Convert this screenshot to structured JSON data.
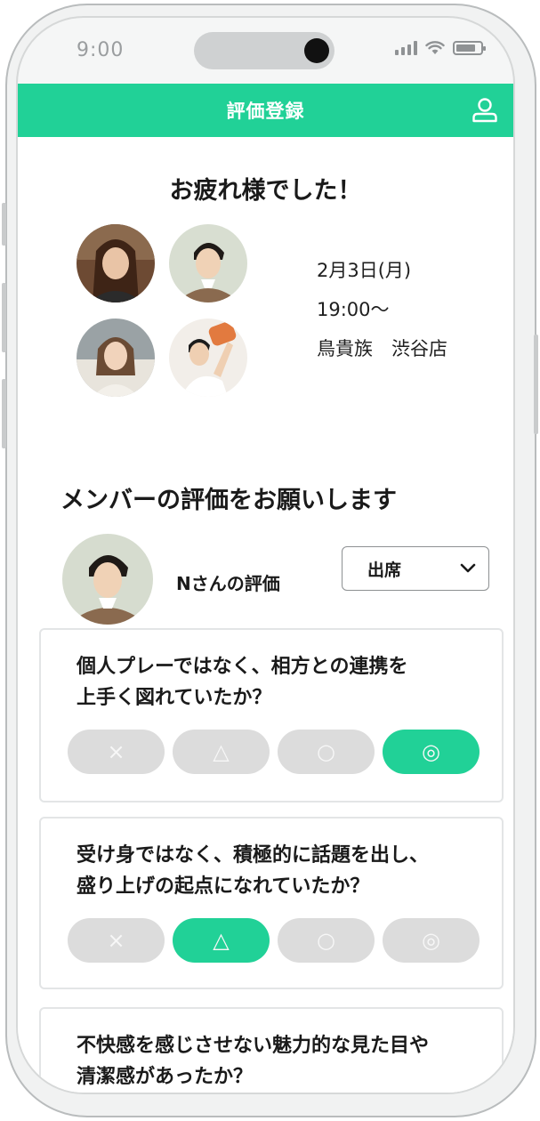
{
  "status_bar": {
    "time": "9:00"
  },
  "header": {
    "title": "評価登録",
    "user_icon": "user-icon",
    "color": "#21d197"
  },
  "greeting": "お疲れ様でした！",
  "event": {
    "date": "2月3日(月)",
    "time": "19:00〜",
    "place": "鳥貴族　渋谷店"
  },
  "section_title": "メンバーの評価をお願いします",
  "member": {
    "label": "Nさんの評価",
    "attendance": "出席",
    "dropdown_icon": "chevron-down-icon"
  },
  "rating_symbols": [
    "×",
    "△",
    "○",
    "◎"
  ],
  "questions": [
    {
      "line1": "個人プレーではなく、相方との連携を",
      "line2": "上手く図れていたか？",
      "selected": "◎"
    },
    {
      "line1": "受け身ではなく、積極的に話題を出し、",
      "line2": "盛り上げの起点になれていたか？",
      "selected": "△"
    },
    {
      "line1": "不快感を感じさせない魅力的な見た目や",
      "line2": "清潔感があったか？",
      "selected": ""
    }
  ]
}
